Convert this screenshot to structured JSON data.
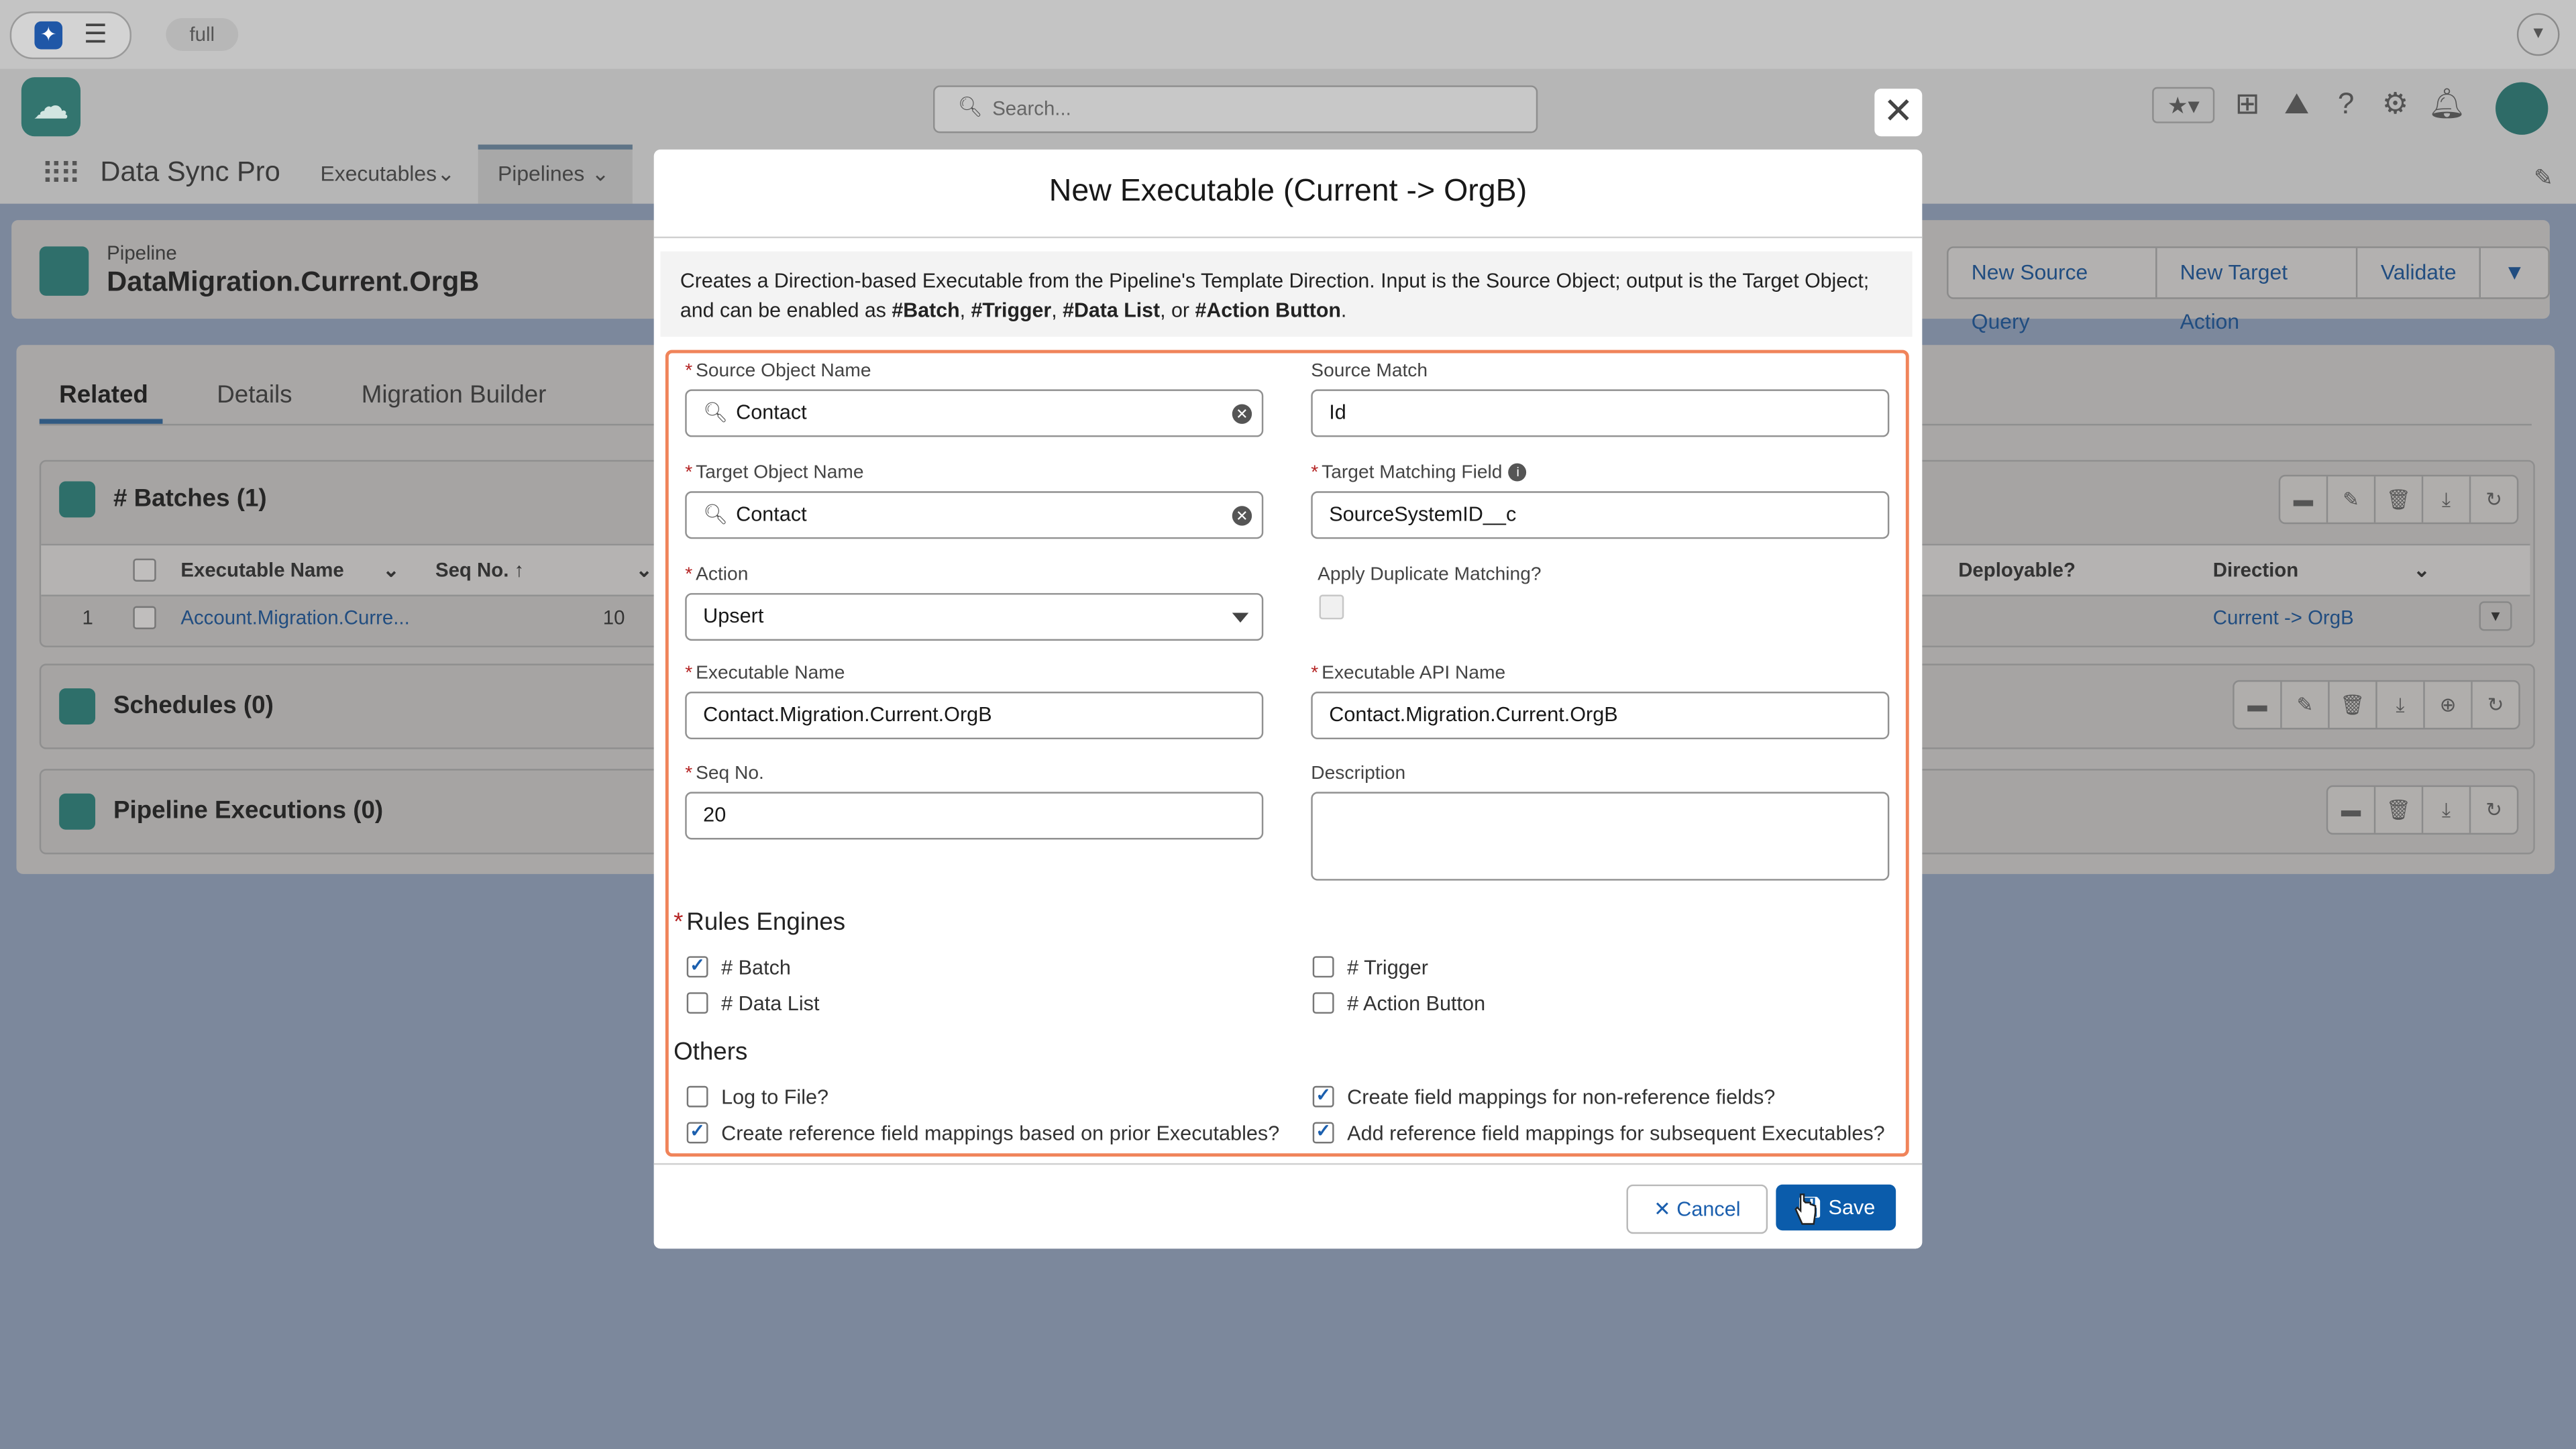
{
  "topbar": {
    "env_label": "full"
  },
  "header": {
    "search_placeholder": "Search..."
  },
  "nav": {
    "app_name": "Data Sync Pro",
    "items": [
      "Executables",
      "Pipelines"
    ]
  },
  "record": {
    "type": "Pipeline",
    "name": "DataMigration.Current.OrgB",
    "actions": [
      "New Source Query",
      "New Target Action",
      "Validate"
    ]
  },
  "tabs": [
    "Related",
    "Details",
    "Migration Builder"
  ],
  "related": {
    "batches_title": "# Batches (1)",
    "schedules_title": "Schedules (0)",
    "executions_title": "Pipeline Executions (0)",
    "columns": {
      "name": "Executable Name",
      "seq": "Seq No. ↑",
      "deployable": "Deployable?",
      "direction": "Direction"
    },
    "row": {
      "num": "1",
      "name": "Account.Migration.Curre...",
      "seq": "10",
      "direction": "Current  -> OrgB"
    }
  },
  "modal": {
    "title": "New Executable (Current  ->  OrgB)",
    "description_prefix": "Creates a Direction-based Executable from the Pipeline's Template Direction. Input is the Source Object; output is the Target Object; and can be enabled as ",
    "tag_batch": "#Batch",
    "tag_trigger": "#Trigger",
    "tag_datalist": "#Data List",
    "tag_action": "#Action Button",
    "source_object": {
      "label": "Source Object Name",
      "value": "Contact"
    },
    "source_match": {
      "label": "Source Match",
      "value": "Id"
    },
    "target_object": {
      "label": "Target Object Name",
      "value": "Contact"
    },
    "target_field": {
      "label": "Target Matching Field",
      "value": "SourceSystemID__c"
    },
    "action": {
      "label": "Action",
      "value": "Upsert"
    },
    "dup_matching": {
      "label": "Apply Duplicate Matching?"
    },
    "exec_name": {
      "label": "Executable Name",
      "value": "Contact.Migration.Current.OrgB"
    },
    "api_name": {
      "label": "Executable API Name",
      "value": "Contact.Migration.Current.OrgB"
    },
    "seq": {
      "label": "Seq No.",
      "value": "20"
    },
    "description": {
      "label": "Description"
    },
    "rules_title": "Rules Engines",
    "rules": {
      "batch": "# Batch",
      "trigger": "# Trigger",
      "datalist": "# Data List",
      "action": "# Action Button"
    },
    "others_title": "Others",
    "others": {
      "log": "Log to File?",
      "nonref": "Create field mappings for non-reference fields?",
      "prior": "Create reference field mappings based on prior Executables?",
      "subsequent": "Add reference field mappings for subsequent Executables?"
    },
    "cancel": "Cancel",
    "save": "Save"
  }
}
